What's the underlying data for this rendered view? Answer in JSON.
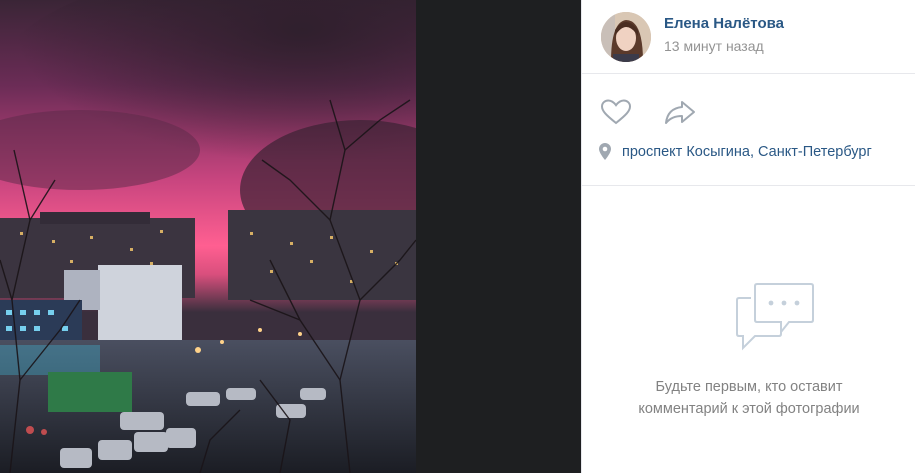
{
  "author": {
    "name": "Елена Налётова",
    "time": "13 минут назад"
  },
  "actions": {
    "like_icon": "heart-icon",
    "share_icon": "share-arrow-icon"
  },
  "location": {
    "icon": "map-pin-icon",
    "text": "проспект Косыгина, Санкт-Петербург"
  },
  "comments": {
    "icon": "chat-bubbles-icon",
    "empty_line1": "Будьте первым, кто оставит",
    "empty_line2": "комментарий к этой фотографии"
  },
  "colors": {
    "link": "#2a5885",
    "muted": "#939393",
    "icon": "#a0a8b1",
    "viewer_bg": "#1e1f21"
  }
}
